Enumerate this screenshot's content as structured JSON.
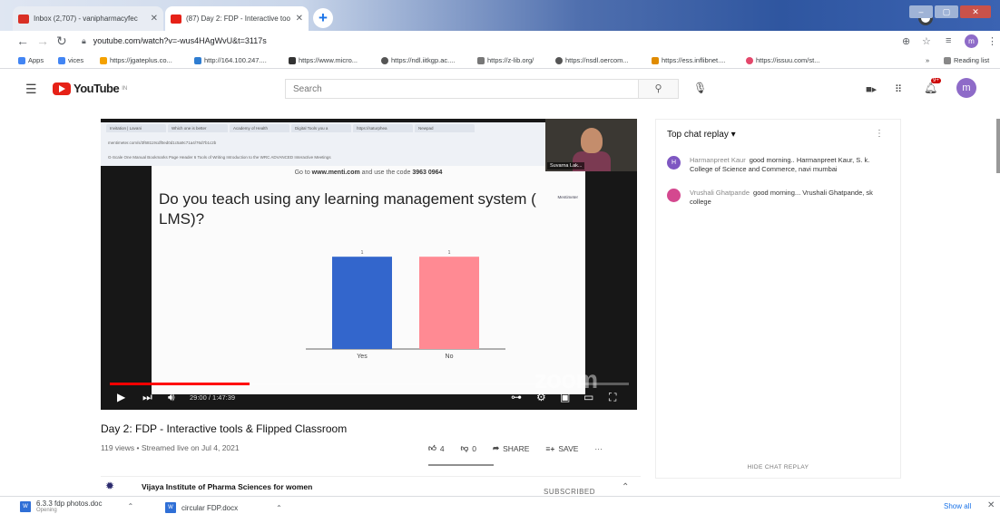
{
  "browser": {
    "tabs": [
      {
        "title": "Inbox (2,707) - vanipharmacyfec",
        "favicon_color": "#d93025",
        "active": false
      },
      {
        "title": "(87) Day 2: FDP - Interactive too",
        "favicon_color": "#e62117",
        "active": true
      }
    ],
    "new_tab": "+",
    "url": "youtube.com/watch?v=-wus4HAgWvU&t=3117s",
    "bookmarks": [
      {
        "label": "Apps",
        "color": "#4285f4"
      },
      {
        "label": "vices",
        "color": "#4285f4"
      },
      {
        "label": "https://jgateplus.co...",
        "color": "#f4a100"
      },
      {
        "label": "http://164.100.247....",
        "color": "#2f7dd1"
      },
      {
        "label": "https://www.micro...",
        "color": "#333333"
      },
      {
        "label": "https://ndl.iitkgp.ac....",
        "color": "#555555"
      },
      {
        "label": "https://z-lib.org/",
        "color": "#555555"
      },
      {
        "label": "https://nsdl.oercom...",
        "color": "#555555"
      },
      {
        "label": "https://ess.inflibnet....",
        "color": "#e08b00"
      },
      {
        "label": "https://issuu.com/st...",
        "color": "#e4476b"
      }
    ],
    "reading_list": "Reading list"
  },
  "youtube": {
    "logo_text": "YouTube",
    "logo_sup": "IN",
    "search_placeholder": "Search",
    "notification_count": "9+",
    "avatar_letter": "m"
  },
  "player": {
    "inner_tabs": [
      "Invitation | Lavani",
      "Which one is better",
      "Academy of Health",
      "Digital Tools you a",
      "https://saturphea",
      "Newpad"
    ],
    "inner_url": "mentimeter.com/s/3f68119cdf0ed0d1c5a9c71a4/76d7b1c2b",
    "inner_bookmarks": "G-Scale One Manual   Bookmarks   Page Header   6 Tools of Writing   Introduction to the   WRC ADVANCED   Interactive Meetings",
    "instruction_prefix": "Go to ",
    "instruction_site": "www.menti.com",
    "instruction_suffix": " and use the code ",
    "instruction_code": "3963 0964",
    "brand": "Mentimeter",
    "question": "Do you teach using any learning management system ( LMS)?",
    "webcam_name": "Suvarna Lak...",
    "watermark": "zoom",
    "time": "29:00 / 1:47:39"
  },
  "chart_data": {
    "type": "bar",
    "categories": [
      "Yes",
      "No"
    ],
    "values": [
      1,
      1
    ],
    "colors": [
      "#3366cc",
      "#ff8a93"
    ],
    "data_labels": [
      "1",
      "1"
    ],
    "title": "Do you teach using any learning management system ( LMS)?",
    "ylim": [
      0,
      1.1
    ]
  },
  "progress": {
    "played_fraction": 0.27
  },
  "video": {
    "title": "Day 2: FDP - Interactive tools & Flipped Classroom",
    "meta": "119 views • Streamed live on Jul 4, 2021",
    "likes": "4",
    "dislikes": "0",
    "share": "SHARE",
    "save": "SAVE",
    "more": "···",
    "channel": "Vijaya Institute of Pharma Sciences for women",
    "subscribed": "SUBSCRIBED"
  },
  "chat": {
    "header": "Top chat replay",
    "messages": [
      {
        "initial": "H",
        "color": "#7e57c2",
        "author": "Harmanpreet Kaur",
        "text": "good morning.. Harmanpreet Kaur, S. k. College of Science and Commerce, navi mumbai"
      },
      {
        "initial": "",
        "color": "#d4488f",
        "author": "Vrushali Ghatpande",
        "text": "good morning... Vrushali Ghatpande, sk college"
      }
    ],
    "hide_label": "HIDE CHAT REPLAY"
  },
  "downloads": {
    "items": [
      {
        "name": "6.3.3 fdp photos.doc",
        "sub": "Opening"
      },
      {
        "name": "circular FDP.docx",
        "sub": ""
      }
    ],
    "show_all": "Show all"
  }
}
